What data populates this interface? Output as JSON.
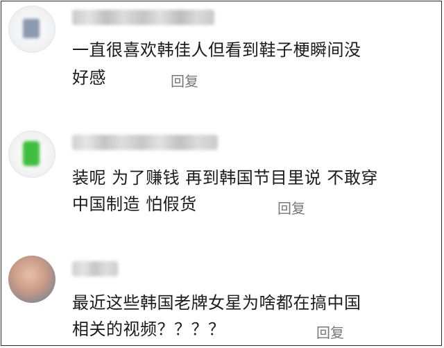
{
  "comments": [
    {
      "avatar_icon": "user-avatar-icon",
      "text_line1": "一直很喜欢韩佳人但看到鞋子梗瞬间没",
      "text_line2": "好感",
      "reply_label": "回复"
    },
    {
      "avatar_icon": "user-avatar-icon",
      "text_line1": "装呢 为了赚钱 再到韩国节目里说 不敢穿",
      "text_line2": "中国制造 怕假货",
      "reply_label": "回复"
    },
    {
      "avatar_icon": "user-avatar-icon",
      "text_line1": "最近这些韩国老牌女星为啥都在搞中国",
      "text_line2": "相关的视频？？？？",
      "reply_label": "回复"
    }
  ],
  "colors": {
    "text": "#1b1b1b",
    "reply": "#777777",
    "border": "#2a2a2a"
  }
}
